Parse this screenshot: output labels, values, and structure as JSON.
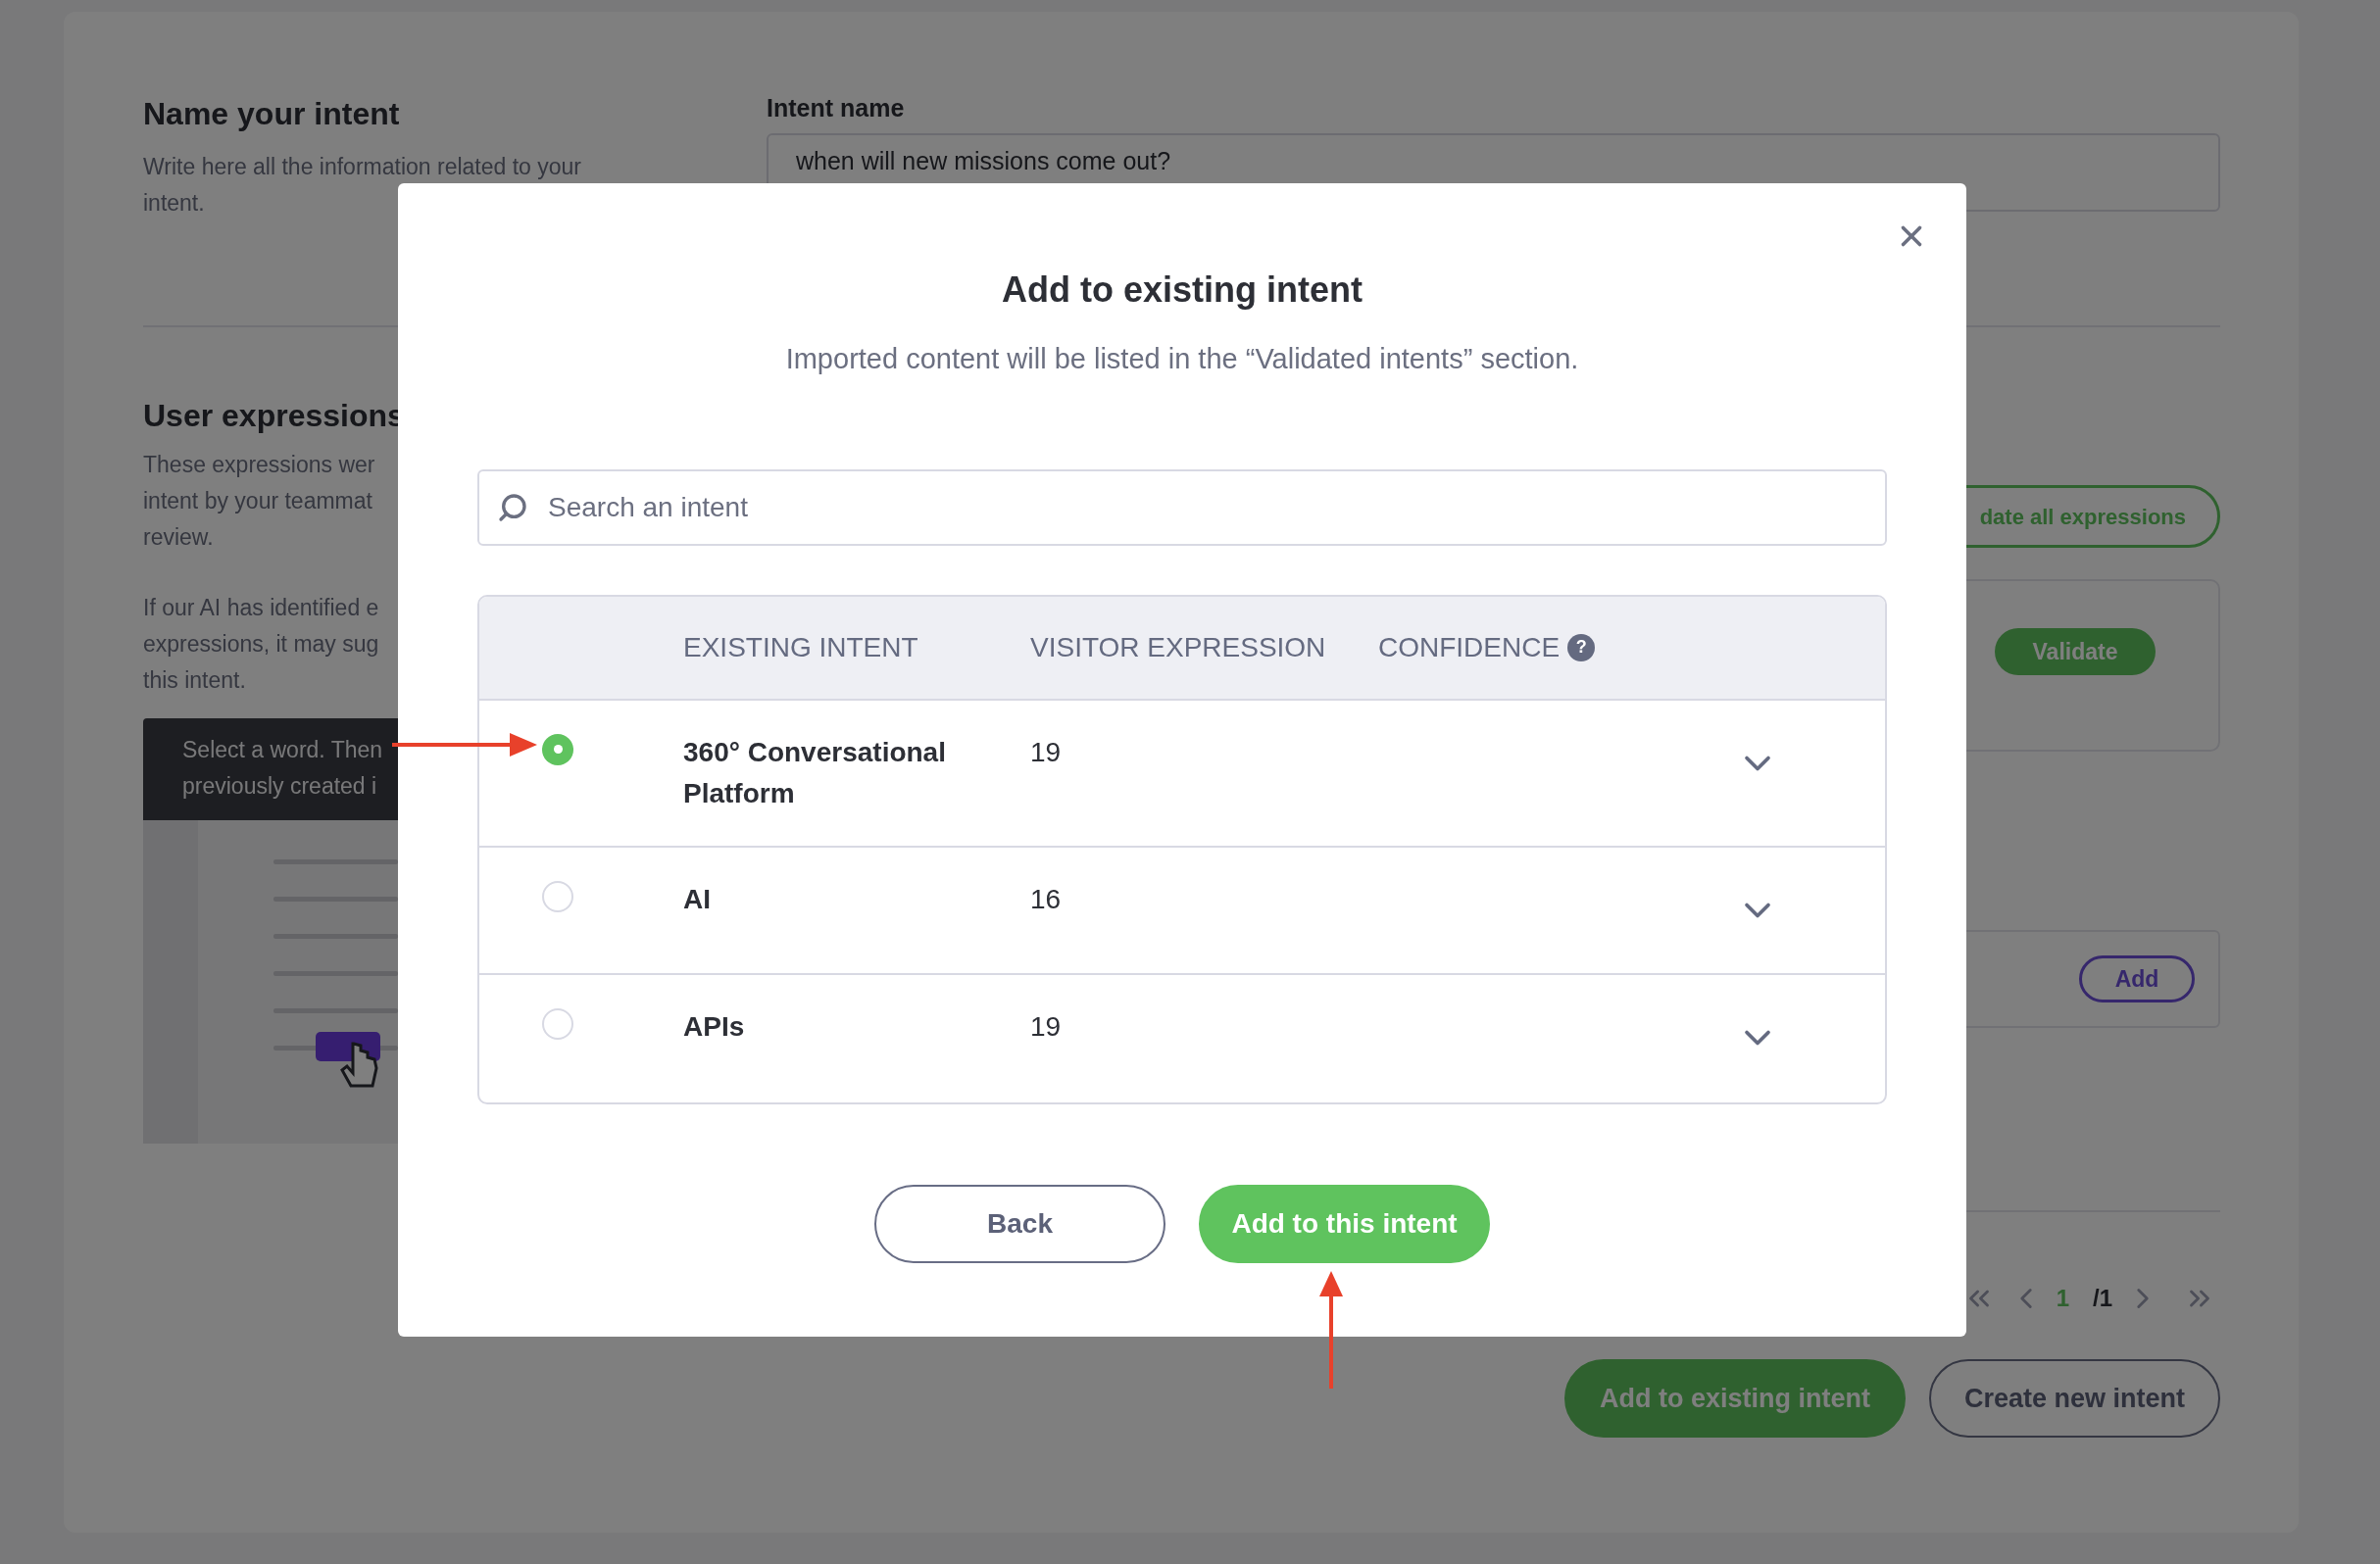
{
  "name_section": {
    "title": "Name your intent",
    "description": "Write here all the information related to your intent."
  },
  "intent_name": {
    "label": "Intent name",
    "value": "when will new missions come out?"
  },
  "user_expressions": {
    "title": "User expressions",
    "paragraphs": [
      [
        "These expressions wer",
        "intent by your teammat",
        "review."
      ],
      [
        "If our AI has identified e",
        "expressions, it may sug",
        "this intent."
      ]
    ],
    "tip": [
      "Select a word. Then",
      "previously created i"
    ]
  },
  "validate_all_button": "date all expressions",
  "validate_button": "Validate",
  "add_button": "Add",
  "pagination": {
    "current": "1",
    "total": "/1"
  },
  "actions": [
    {
      "label": "Add to existing intent",
      "kind": "primary"
    },
    {
      "label": "Create new intent",
      "kind": "secondary"
    }
  ],
  "modal": {
    "title": "Add to existing intent",
    "subtitle": "Imported content will be listed in the “Validated intents” section.",
    "search": {
      "placeholder": "Search an intent"
    },
    "columns": [
      "EXISTING INTENT",
      "VISITOR EXPRESSION",
      "CONFIDENCE"
    ],
    "help_badge": "?",
    "rows": [
      {
        "name": "360° Conversational Platform",
        "visitor_expression": "19",
        "selected": true
      },
      {
        "name": "AI",
        "visitor_expression": "16",
        "selected": false
      },
      {
        "name": "APIs",
        "visitor_expression": "19",
        "selected": false
      }
    ],
    "buttons": [
      {
        "label": "Back",
        "kind": "secondary"
      },
      {
        "label": "Add to this intent",
        "kind": "primary"
      }
    ]
  }
}
